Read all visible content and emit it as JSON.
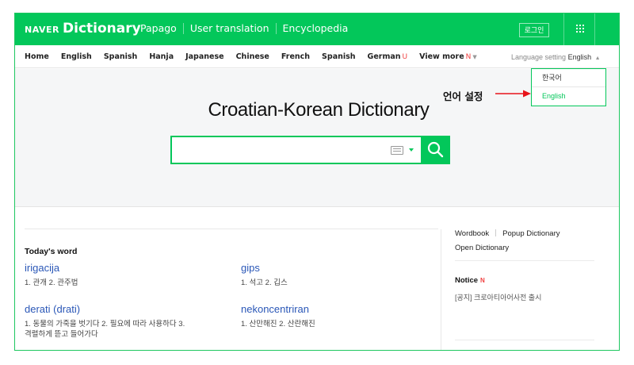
{
  "topbar": {
    "naver_logo": "NAVER",
    "dict_logo": "Dictionary",
    "nav": [
      "Papago",
      "User translation",
      "Encyclopedia"
    ],
    "login_label": "로그인"
  },
  "langbar": {
    "items": [
      {
        "label": "Home"
      },
      {
        "label": "English"
      },
      {
        "label": "Spanish"
      },
      {
        "label": "Hanja"
      },
      {
        "label": "Japanese"
      },
      {
        "label": "Chinese"
      },
      {
        "label": "French"
      },
      {
        "label": "Spanish"
      },
      {
        "label": "German",
        "badge": "U"
      },
      {
        "label": "View more",
        "badge": "N"
      }
    ],
    "setting_label": "Language setting",
    "setting_value": "English"
  },
  "lang_popup": {
    "options": [
      "한국어",
      "English"
    ],
    "selected": "English"
  },
  "annotation": {
    "label": "언어 설정",
    "arrow_color": "#e8141b"
  },
  "hero": {
    "title": "Croatian-Korean Dictionary",
    "search_value": ""
  },
  "todays_word": {
    "title": "Today's word",
    "words": [
      {
        "word": "irigacija",
        "meaning": "1. 관개 2. 관주법"
      },
      {
        "word": "gips",
        "meaning": "1. 석고 2. 깁스"
      },
      {
        "word": "derati (drati)",
        "meaning_lines": [
          "1. 동물의 가죽을 벗기다 2. 필요에 따라 사용하다 3.",
          "격렬하게 뜯고 들어가다"
        ]
      },
      {
        "word": "nekoncentriran",
        "meaning": "1. 산만해진 2. 산란해진"
      }
    ]
  },
  "side": {
    "links": [
      "Wordbook",
      "Popup Dictionary",
      "Open Dictionary"
    ],
    "notice_title": "Notice",
    "notice_badge": "N",
    "notice_item": "[공지] 크로아티아어사전 출시"
  },
  "colors": {
    "brand": "#03c75a",
    "link": "#2a57b7",
    "badge": "#f04040"
  }
}
